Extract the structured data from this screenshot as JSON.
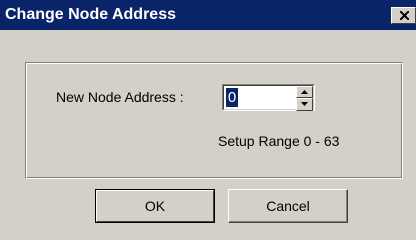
{
  "dialog": {
    "title": "Change Node Address",
    "close_icon": "close-icon",
    "address_label": "New Node Address :",
    "address_value": "0",
    "range_text": "Setup Range 0 - 63",
    "ok_label": "OK",
    "cancel_label": "Cancel"
  },
  "colors": {
    "titlebar": "#0a246a",
    "face": "#d4d0c8",
    "selection": "#0a246a"
  }
}
